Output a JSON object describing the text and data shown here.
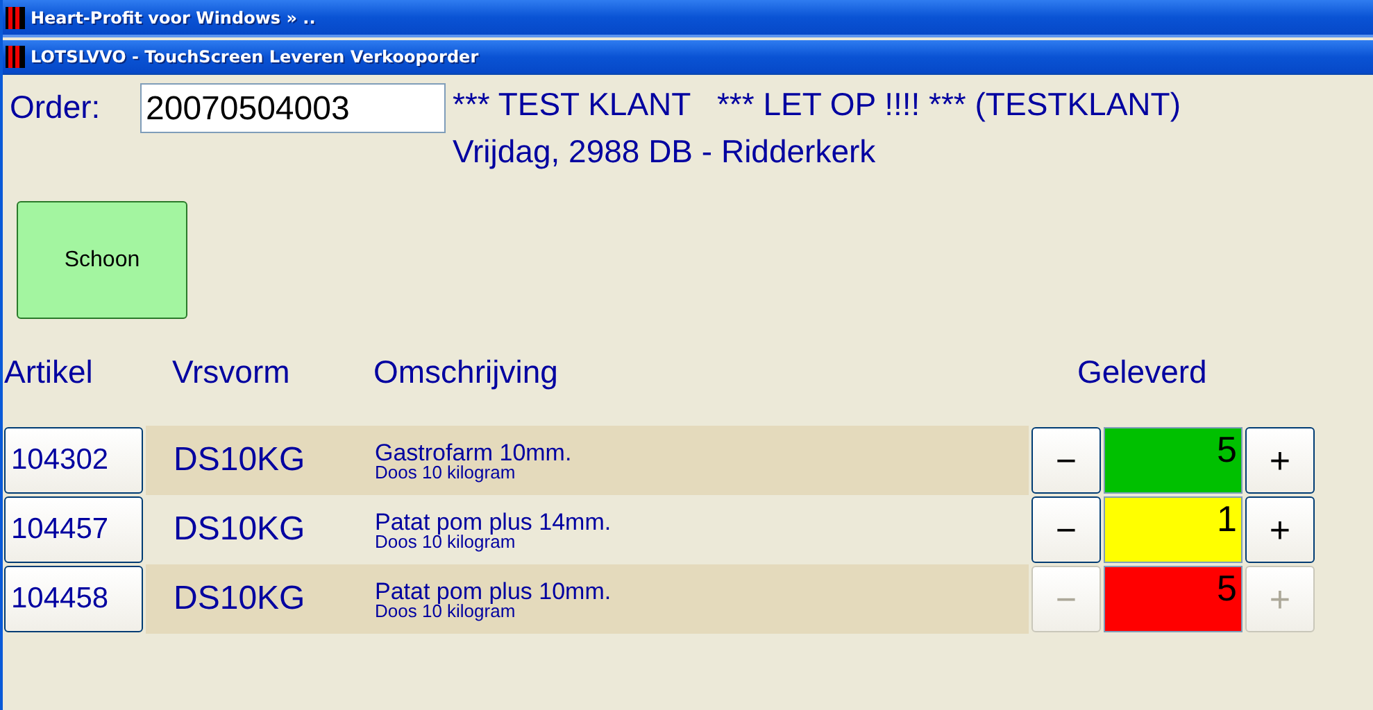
{
  "window": {
    "title": "Heart-Profit voor Windows  »  .."
  },
  "subwindow": {
    "title": "LOTSLVVO - TouchScreen Leveren Verkooporder"
  },
  "order": {
    "label": "Order:",
    "value": "20070504003",
    "customer_lines": [
      "*** TEST KLANT   *** LET OP !!!! *** (TESTKLANT)",
      "Vrijdag, 2988 DB - Ridderkerk"
    ]
  },
  "action_button": "Schoon",
  "table": {
    "columns": [
      "Artikel",
      "Vrsvorm",
      "Omschrijving",
      "Geleverd"
    ],
    "rows": [
      {
        "article": "104302",
        "unit": "DS10KG",
        "description": "Gastrofarm 10mm.",
        "subdescription": "Doos 10 kilogram",
        "minus": "−",
        "quantity": "5",
        "plus": "+",
        "color": "#00c000",
        "disabled": false
      },
      {
        "article": "104457",
        "unit": "DS10KG",
        "description": "Patat pom plus 14mm.",
        "subdescription": "Doos 10 kilogram",
        "minus": "−",
        "quantity": "1",
        "plus": "+",
        "color": "#ffff00",
        "disabled": false
      },
      {
        "article": "104458",
        "unit": "DS10KG",
        "description": "Patat pom plus 10mm.",
        "subdescription": "Doos 10 kilogram",
        "minus": "−",
        "quantity": "5",
        "plus": "+",
        "color": "#ff0000",
        "disabled": true
      }
    ]
  }
}
